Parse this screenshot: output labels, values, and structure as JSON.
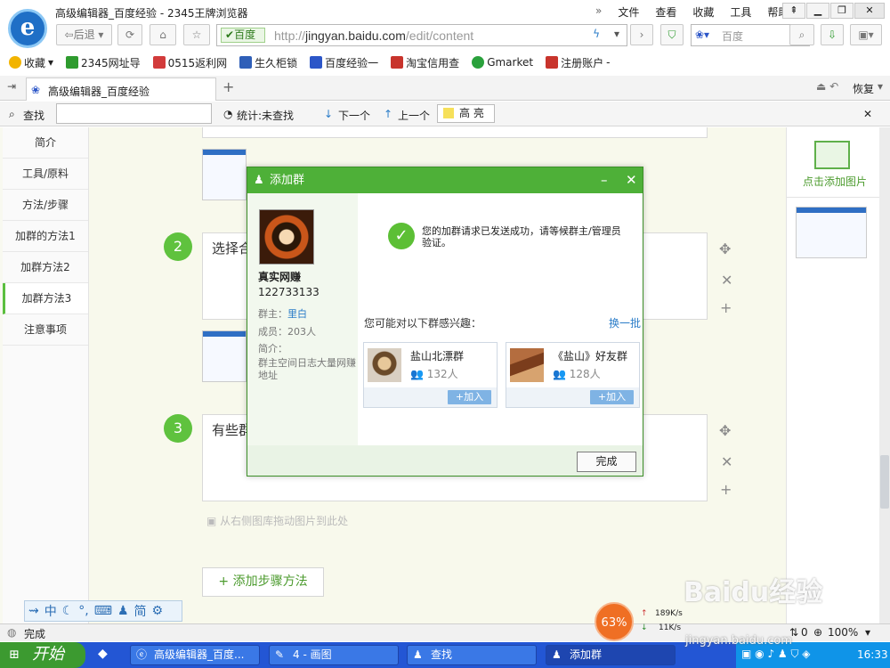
{
  "window": {
    "title": "高级编辑器_百度经验 - 2345王牌浏览器",
    "menus": [
      "文件",
      "查看",
      "收藏",
      "工具",
      "帮助"
    ]
  },
  "nav": {
    "back_label": "后退",
    "shield_label": "百度",
    "url_host": "jingyan.baidu.com",
    "url_prefix": "http://",
    "url_path": "/edit/content",
    "search_placeholder": "百度"
  },
  "bookmarks": [
    {
      "label": "收藏",
      "color": "#f2b400"
    },
    {
      "label": "2345网址导",
      "color": "#2e9b2e"
    },
    {
      "label": "0515返利网",
      "color": "#d23b3b"
    },
    {
      "label": "生久柜锁",
      "color": "#2f5fb8"
    },
    {
      "label": "百度经验一",
      "color": "#2c56c8"
    },
    {
      "label": "淘宝信用查",
      "color": "#c8342c"
    },
    {
      "label": "Gmarket",
      "color": "#2aa13c"
    },
    {
      "label": "注册账户",
      "color": "#c8342c"
    }
  ],
  "tab": {
    "label": "高级编辑器_百度经验",
    "restore_label": "恢复"
  },
  "findbar": {
    "find_label": "查找",
    "stats_label": "统计:未查找",
    "next_label": "下一个",
    "prev_label": "上一个",
    "highlight_label": "高 亮"
  },
  "leftnav": [
    "简介",
    "工具/原料",
    "方法/步骤",
    "加群的方法1",
    "加群方法2",
    "加群方法3",
    "注意事项"
  ],
  "steps": {
    "step2_num": "2",
    "step2_text": "选择合",
    "step3_num": "3",
    "step3_text": "有些群",
    "drag_hint": "从右侧图库拖动图片到此处",
    "add_step": "+ 添加步骤方法"
  },
  "rightpanel": {
    "add_image": "点击添加图片"
  },
  "dialog": {
    "title": "添加群",
    "group_name": "真实网赚",
    "group_number": "122733133",
    "owner_label": "群主：",
    "owner_value": "里白",
    "members_label": "成员：",
    "members_value": "203人",
    "intro_label": "简介：",
    "intro_value": "群主空间日志大量网赚地址",
    "success_msg": "您的加群请求已发送成功，请等候群主/管理员验证。",
    "interest_label": "您可能对以下群感兴趣：",
    "swap_label": "换一批",
    "groups": [
      {
        "name": "盐山北漂群",
        "count": "132人",
        "join": "+加入"
      },
      {
        "name": "《盐山》好友群",
        "count": "128人",
        "join": "+加入"
      }
    ],
    "done_label": "完成"
  },
  "ime": {
    "chars": [
      "中",
      "简"
    ]
  },
  "status": {
    "text": "完成",
    "zoom": "100%",
    "cpu": "63%",
    "up": "189K/s",
    "down": "11K/s",
    "counter": "0"
  },
  "taskbar": {
    "start": "开始",
    "tasks": [
      "高级编辑器_百度...",
      "4 - 画图",
      "查找",
      "添加群"
    ],
    "clock": "16:33"
  },
  "watermark": {
    "brand": "Baidu经验",
    "site": "jingyan.baidu.com"
  },
  "colors": {
    "accent_green": "#4eb038",
    "link_blue": "#2a7cc8",
    "taskbar_blue": "#2356d4"
  }
}
